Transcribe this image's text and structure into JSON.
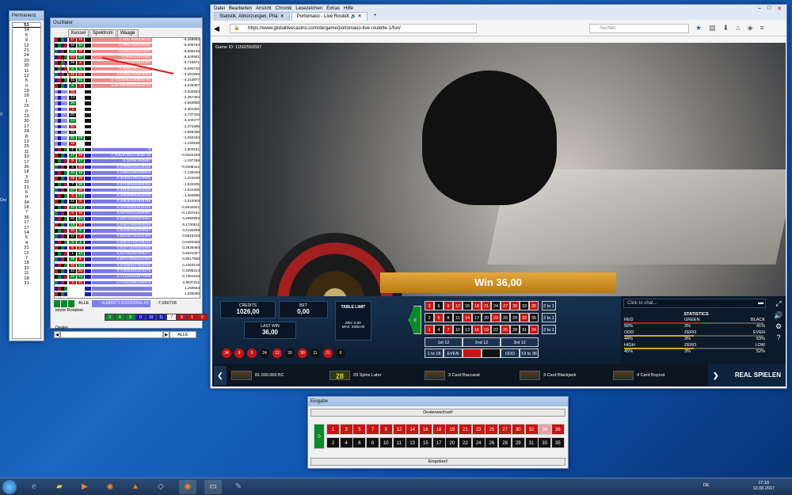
{
  "permanenz": {
    "title": "Permanenz",
    "header": "51",
    "numbers": [
      "34",
      "5",
      "9",
      "12",
      "21",
      "24",
      "20",
      "30",
      "11",
      "12",
      "5",
      "0",
      "19",
      "16",
      "1",
      "15",
      "0",
      "13",
      "30",
      "17",
      "24",
      "8",
      "13",
      "25",
      "11",
      "33",
      "17",
      "36",
      "18",
      "3",
      "33",
      "21",
      "6",
      "0",
      "34",
      "18",
      "7",
      "36",
      "17",
      "17",
      "14",
      "5",
      "4",
      "31",
      "12",
      "7",
      "18",
      "32",
      "11",
      "18",
      "31"
    ]
  },
  "oszillator": {
    "title": "Oszillator",
    "tabs": [
      "Kessel",
      "Spektrum",
      "Waage"
    ],
    "rows": [
      {
        "n1": "17",
        "n2": "19",
        "v1": "1,30314989349173",
        "v2": "-6,459593"
      },
      {
        "n1": "10",
        "n2": "16",
        "v1": "1,08847928100840",
        "v2": "-6,409784"
      },
      {
        "n1": "34",
        "n2": "0",
        "v1": "0,91543438137677",
        "v2": "-5,996149"
      },
      {
        "n1": "23",
        "n2": "27",
        "v1": "0,5594417811883",
        "v2": "-6,440681"
      },
      {
        "n1": "26",
        "n2": "3",
        "v1": "0,14446878812364",
        "v2": "-5,716571"
      },
      {
        "n1": "6",
        "n2": "9",
        "v1": "0,16463485711067",
        "v2": "-5,090725"
      },
      {
        "n1": "22",
        "n2": "24",
        "v1": "-0,104847105008993",
        "v2": "-4,281555"
      },
      {
        "n1": "33",
        "n2": "21",
        "v1": "-1,73133054146360E-02",
        "v2": "-4,310877"
      },
      {
        "n1": "5",
        "n2": "2",
        "v1": "-5,04760030204481E-03",
        "v2": "-4,246367"
      },
      {
        "n1": "25",
        "n2": "",
        "v1": "",
        "v2": "-4,202563"
      },
      {
        "n1": "14",
        "n2": "",
        "v1": "",
        "v2": "-4,357462"
      },
      {
        "n1": "26",
        "n2": "",
        "v1": "",
        "v2": "-4,563856"
      },
      {
        "n1": "1",
        "n2": "",
        "v1": "",
        "v2": "-4,384381"
      },
      {
        "n1": "20",
        "n2": "",
        "v1": "",
        "v2": "-3,737426"
      },
      {
        "n1": "14",
        "n2": "",
        "v1": "",
        "v2": "-3,100277"
      },
      {
        "n1": "31",
        "n2": "",
        "v1": "",
        "v2": "-2,473398"
      },
      {
        "n1": "29",
        "n2": "",
        "v1": "",
        "v2": "-1,956498"
      },
      {
        "n1": "31",
        "n2": "29",
        "v1": "",
        "v2": "-1,250434"
      },
      {
        "n1": "18",
        "n2": "",
        "v1": "",
        "v2": "-1,132536"
      },
      {
        "n1": "2",
        "n2": "16",
        "v1": "0",
        "v2": "-1,504541"
      },
      {
        "n1": "17",
        "n2": "20",
        "v1": "-7,33629736247955E-02",
        "v2": "-0,9322256"
      },
      {
        "n1": "8",
        "n2": "17",
        "v1": "-0,197667463697",
        "v2": "-1,197269"
      },
      {
        "n1": "4",
        "n2": "28",
        "v1": "-0,239660125122316",
        "v2": "-0,6498441"
      },
      {
        "n1": "15",
        "n2": "32",
        "v1": "-0,249522380450845",
        "v2": "-1,136348"
      },
      {
        "n1": "36",
        "n2": "26",
        "v1": "-0,354521700229895",
        "v2": "-1,224248"
      },
      {
        "n1": "7",
        "n2": "26",
        "v1": "-0,372356256689303",
        "v2": "-1,540205"
      },
      {
        "n1": "27",
        "n2": "28",
        "v1": "-0,393393009462006",
        "v2": "-1,044308"
      },
      {
        "n1": "3",
        "n2": "13",
        "v1": "-0,398609694842006",
        "v2": "-1,463905"
      },
      {
        "n1": "21",
        "n2": "8",
        "v1": "-0,408467837588795",
        "v2": "-1,010003"
      },
      {
        "n1": "10",
        "n2": "16",
        "v1": "-0,437558051031231",
        "v2": "-0,5632921"
      },
      {
        "n1": "6",
        "n2": "15",
        "v1": "-0,467502143268997",
        "v2": "-0,1257641"
      },
      {
        "n1": "32",
        "n2": "24",
        "v1": "-0,491734528923867",
        "v2": "0,2960992"
      },
      {
        "n1": "13",
        "n2": "18",
        "v1": "-0,548224656593048",
        "v2": "-0,1700511"
      },
      {
        "n1": "30",
        "n2": "8",
        "v1": "-0,552893364458567",
        "v2": "0,2192685"
      },
      {
        "n1": "11",
        "n2": "7",
        "v1": "-0,560407182222456",
        "v2": "0,5916248"
      },
      {
        "n1": "9",
        "n2": "1",
        "v1": "-0,588157240708234",
        "v2": "0,9465465"
      },
      {
        "n1": "5",
        "n2": "21",
        "v1": "-0,616710268464959",
        "v2": "0,2835494"
      },
      {
        "n1": "1",
        "n2": "13",
        "v1": "-0,627063450398377",
        "v2": "0,6021357"
      },
      {
        "n1": "19",
        "n2": "9",
        "v1": "-0,637148654441664",
        "v2": "0,9017938"
      },
      {
        "n1": "10",
        "n2": "12",
        "v1": "-0,646955447564062",
        "v2": "0,2353216"
      },
      {
        "n1": "23",
        "n2": "30",
        "v1": "-0,700582553402275",
        "v2": "0,4995314"
      },
      {
        "n1": "29",
        "n2": "34",
        "v1": "-0,714446032577836",
        "v2": "0,7351915"
      },
      {
        "n1": "3",
        "n2": "31",
        "v1": "-0,724516691328875",
        "v2": "0,9537311"
      },
      {
        "n1": "",
        "n2": "",
        "v1": "",
        "v2": "1,150563"
      },
      {
        "n1": "",
        "n2": "",
        "v1": "",
        "v2": "1,325086"
      }
    ],
    "bottom_label": "ALLE",
    "bottom_v1": "-4,88097131529306E-02",
    "bottom_v2": "-7,060728",
    "rotation_label": "letzte Rotation",
    "rotation": [
      {
        "v": "3",
        "c": "#0a8a28"
      },
      {
        "v": "6",
        "c": "#0a8a28"
      },
      {
        "v": "9",
        "c": "#0a8a28"
      },
      {
        "v": "0",
        "c": "#1a1ab8"
      },
      {
        "v": "10",
        "c": "#1a1ab8"
      },
      {
        "v": "11",
        "c": "#1a1ab8"
      },
      {
        "v": "7",
        "c": "#ffffff"
      },
      {
        "v": "8",
        "c": "#c81414"
      },
      {
        "v": "1",
        "c": "#c81414"
      },
      {
        "v": "0",
        "c": "#c81414"
      }
    ],
    "dealer_label": "Dealer",
    "select_value": "ALLE"
  },
  "browser": {
    "menu": [
      "Datei",
      "Bearbeiten",
      "Ansicht",
      "Chronik",
      "Lesezeichen",
      "Extras",
      "Hilfe"
    ],
    "tabs": [
      "Statistik, Abkürzungen, Phä: ✕",
      "Portomaso - Live Roulett 🔊 ✕"
    ],
    "url": "https://www.globallivecasino.com/de/game/portomaso-live-roulette-1/fun/",
    "search_placeholder": "Suchen"
  },
  "game": {
    "game_id": "Game ID: 11502550597",
    "win_text": "Win 36,00",
    "credits_label": "CREDITS",
    "credits_value": "1026,00",
    "bet_label": "BET",
    "bet_value": "0,00",
    "lastwin_label": "LAST WIN",
    "lastwin_value": "36,00",
    "table_limit": "TABLE LIMIT",
    "min": "MIN: 0,00",
    "max": "MAX: 2000,00",
    "history": [
      {
        "v": "34",
        "c": "r"
      },
      {
        "v": "9",
        "c": "r"
      },
      {
        "v": "5",
        "c": "r"
      },
      {
        "v": "24",
        "c": "b"
      },
      {
        "v": "12",
        "c": "r"
      },
      {
        "v": "20",
        "c": "b"
      },
      {
        "v": "30",
        "c": "r"
      },
      {
        "v": "11",
        "c": "b"
      },
      {
        "v": "21",
        "c": "r"
      },
      {
        "v": "6",
        "c": "b"
      }
    ],
    "row3": [
      {
        "v": "3",
        "c": "r"
      },
      {
        "v": "6",
        "c": "b"
      },
      {
        "v": "9",
        "c": "r"
      },
      {
        "v": "12",
        "c": "r"
      },
      {
        "v": "15",
        "c": "b"
      },
      {
        "v": "18",
        "c": "r"
      },
      {
        "v": "21",
        "c": "r"
      },
      {
        "v": "24",
        "c": "b"
      },
      {
        "v": "27",
        "c": "r"
      },
      {
        "v": "30",
        "c": "r"
      },
      {
        "v": "33",
        "c": "b"
      },
      {
        "v": "36",
        "c": "r"
      }
    ],
    "row2": [
      {
        "v": "2",
        "c": "b"
      },
      {
        "v": "5",
        "c": "r"
      },
      {
        "v": "8",
        "c": "b"
      },
      {
        "v": "11",
        "c": "b"
      },
      {
        "v": "14",
        "c": "r"
      },
      {
        "v": "17",
        "c": "b"
      },
      {
        "v": "20",
        "c": "b"
      },
      {
        "v": "23",
        "c": "r"
      },
      {
        "v": "26",
        "c": "b"
      },
      {
        "v": "29",
        "c": "b"
      },
      {
        "v": "32",
        "c": "r"
      },
      {
        "v": "35",
        "c": "b"
      }
    ],
    "row1": [
      {
        "v": "1",
        "c": "r"
      },
      {
        "v": "4",
        "c": "b"
      },
      {
        "v": "7",
        "c": "r"
      },
      {
        "v": "10",
        "c": "b"
      },
      {
        "v": "13",
        "c": "b"
      },
      {
        "v": "16",
        "c": "r"
      },
      {
        "v": "19",
        "c": "r"
      },
      {
        "v": "22",
        "c": "b"
      },
      {
        "v": "25",
        "c": "r"
      },
      {
        "v": "28",
        "c": "b"
      },
      {
        "v": "31",
        "c": "b"
      },
      {
        "v": "34",
        "c": "r"
      }
    ],
    "zero": "0",
    "col_bet": "2 to 1",
    "dozens": [
      "1st 12",
      "2nd 12",
      "3rd 12"
    ],
    "outside": [
      "1 to 18",
      "EVEN",
      "ODD",
      "19 to 36"
    ],
    "chat_placeholder": "Click to chat...",
    "statistics": {
      "title": "STATISTICS",
      "rows": [
        {
          "l": "RED",
          "m": "GREEN",
          "r": "BLACK"
        },
        {
          "l": "56%",
          "m": "3%",
          "r": "41%"
        },
        {
          "l": "ODD",
          "m": "ZERO",
          "r": "EVEN"
        },
        {
          "l": "44%",
          "m": "3%",
          "r": "53%"
        },
        {
          "l": "HIGH",
          "m": "ZERO",
          "r": "LOW"
        },
        {
          "l": "45%",
          "m": "3%",
          "r": "52%"
        }
      ]
    },
    "strip": [
      "81.000.000 BC",
      "29 Spins Later",
      "3 Card Baccarat",
      "3 Card Blackjack",
      "4 Card Boyout"
    ],
    "strip_badge": "28",
    "real_play": "REAL SPIELEN"
  },
  "eingabe": {
    "title": "Eingabe",
    "dealer_change": "Dealerwechsel!",
    "zero": "0",
    "top": [
      {
        "v": "1",
        "c": "r"
      },
      {
        "v": "3",
        "c": "r"
      },
      {
        "v": "5",
        "c": "r"
      },
      {
        "v": "7",
        "c": "r"
      },
      {
        "v": "9",
        "c": "r"
      },
      {
        "v": "12",
        "c": "r"
      },
      {
        "v": "14",
        "c": "r"
      },
      {
        "v": "16",
        "c": "r"
      },
      {
        "v": "18",
        "c": "r"
      },
      {
        "v": "19",
        "c": "r"
      },
      {
        "v": "21",
        "c": "r"
      },
      {
        "v": "23",
        "c": "r"
      },
      {
        "v": "25",
        "c": "r"
      },
      {
        "v": "27",
        "c": "r"
      },
      {
        "v": "30",
        "c": "r"
      },
      {
        "v": "32",
        "c": "r"
      },
      {
        "v": "34",
        "c": "p"
      },
      {
        "v": "36",
        "c": "r"
      }
    ],
    "bottom": [
      {
        "v": "2",
        "c": "b"
      },
      {
        "v": "4",
        "c": "b"
      },
      {
        "v": "6",
        "c": "b"
      },
      {
        "v": "8",
        "c": "b"
      },
      {
        "v": "10",
        "c": "b"
      },
      {
        "v": "11",
        "c": "b"
      },
      {
        "v": "13",
        "c": "b"
      },
      {
        "v": "15",
        "c": "b"
      },
      {
        "v": "17",
        "c": "b"
      },
      {
        "v": "20",
        "c": "b"
      },
      {
        "v": "22",
        "c": "b"
      },
      {
        "v": "24",
        "c": "b"
      },
      {
        "v": "26",
        "c": "b"
      },
      {
        "v": "28",
        "c": "b"
      },
      {
        "v": "29",
        "c": "b"
      },
      {
        "v": "31",
        "c": "b"
      },
      {
        "v": "33",
        "c": "b"
      },
      {
        "v": "35",
        "c": "b"
      }
    ],
    "button": "Eingeben!"
  },
  "taskbar": {
    "lang": "DE",
    "time": "17:10",
    "date": "12.08.2017"
  }
}
